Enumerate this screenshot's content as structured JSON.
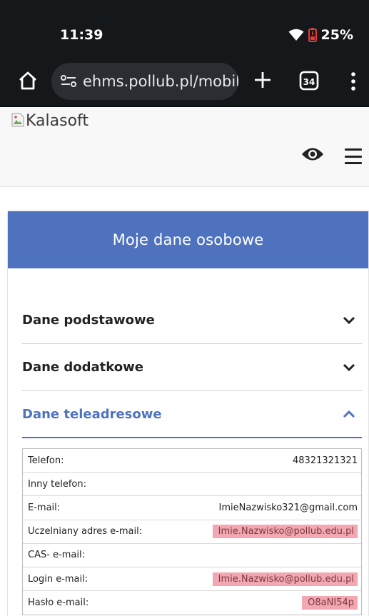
{
  "status_bar": {
    "time": "11:39",
    "battery": "25%",
    "icons": [
      "wifi-icon",
      "battery-low-icon"
    ]
  },
  "browser": {
    "url": "ehms.pollub.pl/mobile",
    "tab_count": "34",
    "icons": [
      "home-icon",
      "site-settings-icon",
      "plus-icon",
      "tabs-icon",
      "kebab-menu-icon"
    ]
  },
  "site_header": {
    "logo_alt": "Kalasoft",
    "icons": [
      "broken-image-icon",
      "eye-icon",
      "hamburger-icon"
    ]
  },
  "card": {
    "title": "Moje dane osobowe",
    "sections": [
      {
        "title": "Dane podstawowe",
        "expanded": false
      },
      {
        "title": "Dane dodatkowe",
        "expanded": false
      },
      {
        "title": "Dane teleadresowe",
        "expanded": true
      }
    ],
    "table": [
      {
        "label": "Telefon:",
        "value": "48321321321"
      },
      {
        "label": "Inny telefon:",
        "value": ""
      },
      {
        "label": "E-mail:",
        "value": "ImieNazwisko321@gmail.com"
      },
      {
        "label": "Uczelniany adres e-mail:",
        "value": "Imie.Nazwisko@pollub.edu.pl"
      },
      {
        "label": "CAS- e-mail:",
        "value": ""
      },
      {
        "label": "Login e-mail:",
        "value": "Imie.Nazwisko@pollub.edu.pl"
      },
      {
        "label": "Hasło e-mail:",
        "value": "O8aNI54p"
      }
    ]
  },
  "colors": {
    "status_bg": "#15181b",
    "url_pill": "#2a2d31",
    "accent": "#4f72bf",
    "highlight": "#f3a7b2"
  }
}
